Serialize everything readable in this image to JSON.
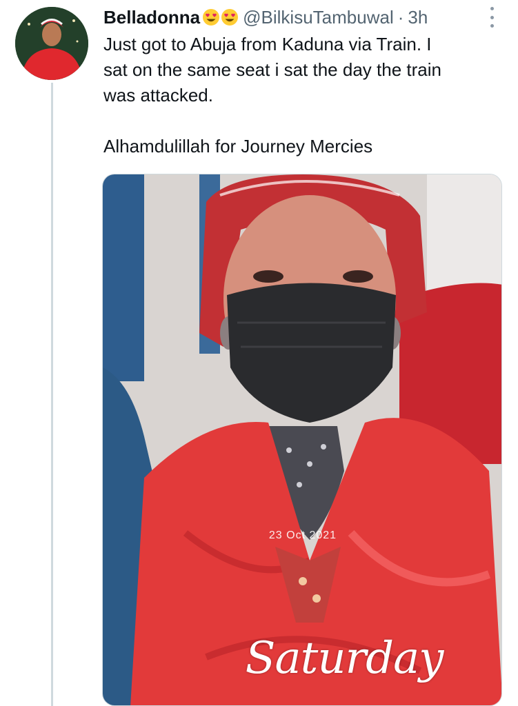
{
  "tweet": {
    "display_name": "Belladonna",
    "name_emojis": [
      "heart-eyes-emoji",
      "heart-eyes-emoji"
    ],
    "handle": "@BilkisuTambuwal",
    "separator": "·",
    "time": "3h",
    "text": "Just got to Abuja from Kaduna via Train. I\nsat on the same seat i sat the day the train\nwas attacked.\n\nAlhamdulillah for Journey Mercies",
    "more_icon": "more-vertical-icon"
  },
  "media": {
    "overlay_script": "Saturday",
    "overlay_date": "23 Oct 2021"
  },
  "colors": {
    "text_primary": "#0f1419",
    "text_secondary": "#536471",
    "thread_line": "#cfd9de",
    "avatar_outfit": "#e0282e",
    "scarf_red": "#e23a3a"
  }
}
